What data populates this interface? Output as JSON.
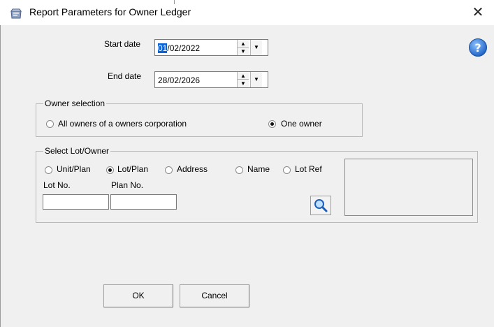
{
  "window": {
    "title": "Report Parameters for Owner Ledger",
    "close_glyph": "✕"
  },
  "dates": {
    "start_label": "Start date",
    "start_day": "01",
    "start_rest": "/02/2022",
    "end_label": "End date",
    "end_value": "28/02/2026"
  },
  "owner_selection": {
    "legend": "Owner selection",
    "option_all": "All owners of a owners corporation",
    "option_one": "One owner",
    "selected": "One owner"
  },
  "select_lot_owner": {
    "legend": "Select Lot/Owner",
    "options": [
      "Unit/Plan",
      "Lot/Plan",
      "Address",
      "Name",
      "Lot Ref"
    ],
    "selected": "Lot/Plan",
    "lot_no_label": "Lot No.",
    "plan_no_label": "Plan No.",
    "lot_no_value": "",
    "plan_no_value": ""
  },
  "buttons": {
    "ok": "OK",
    "cancel": "Cancel"
  },
  "icons": {
    "app": "report-app-icon",
    "help": "help-icon",
    "search": "search-magnifier-icon",
    "spinner": "spin-up-down-icon",
    "dropdown": "calendar-dropdown-icon"
  },
  "colors": {
    "selection": "#0a64d8",
    "help_blue": "#2f7fd8"
  }
}
